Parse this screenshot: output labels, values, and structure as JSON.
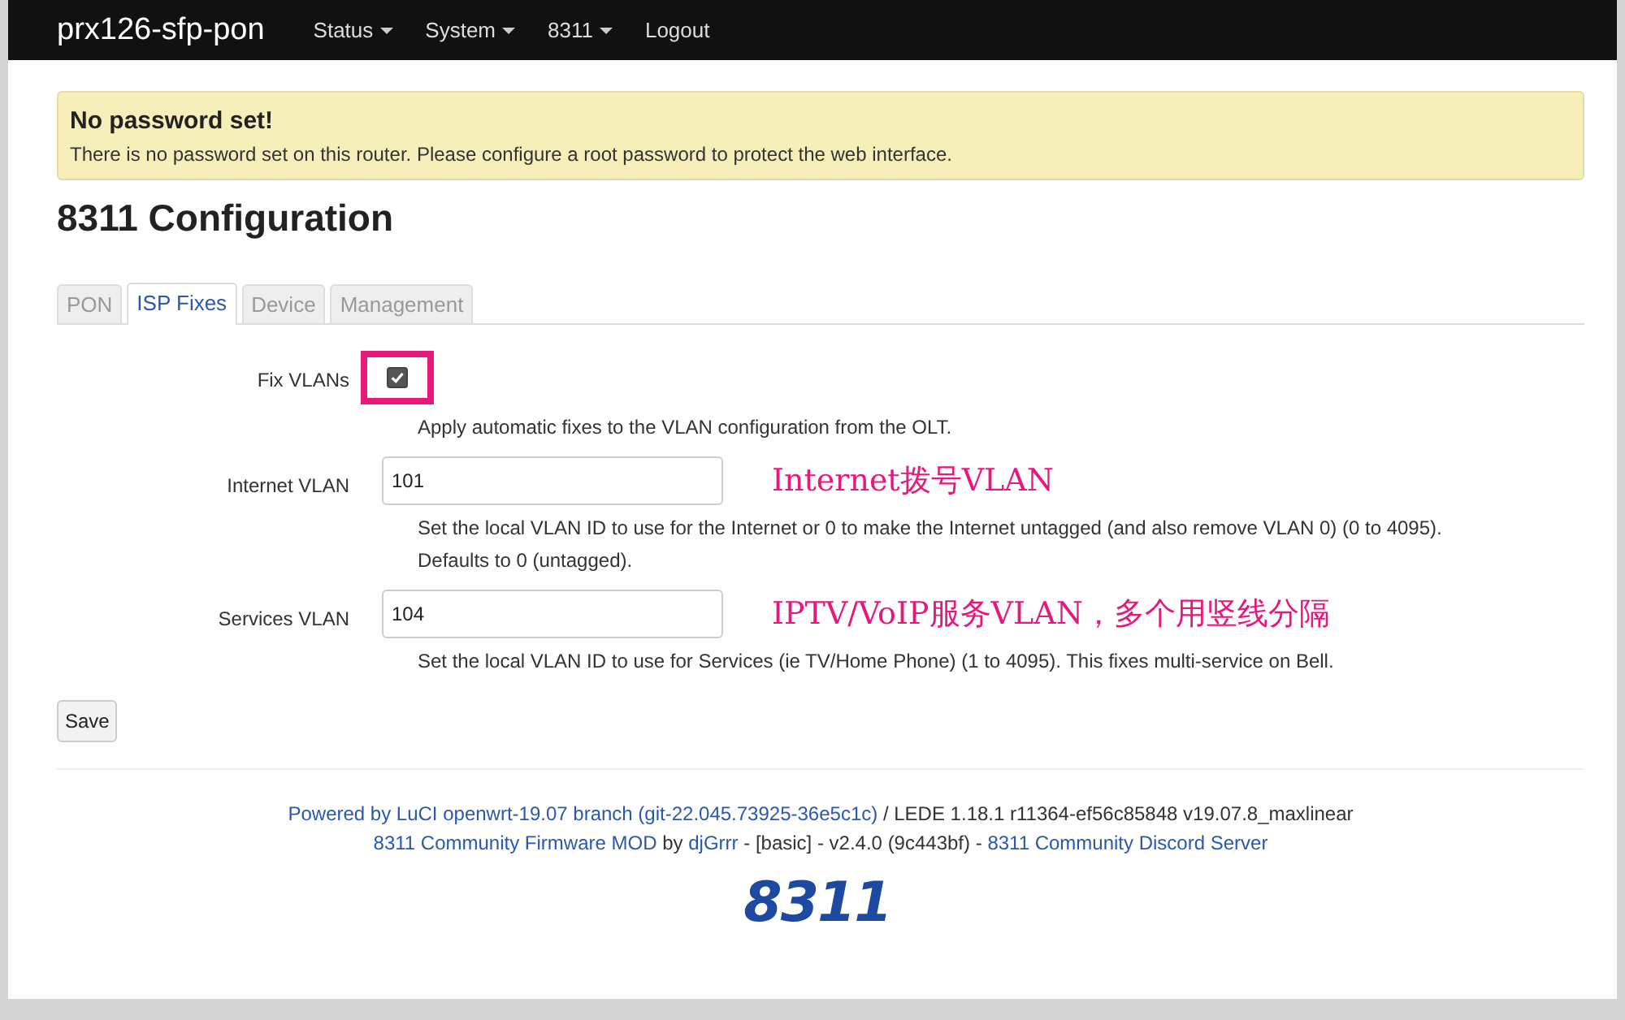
{
  "navbar": {
    "brand": "prx126-sfp-pon",
    "menus": [
      {
        "label": "Status",
        "dropdown": true
      },
      {
        "label": "System",
        "dropdown": true
      },
      {
        "label": "8311",
        "dropdown": true
      },
      {
        "label": "Logout",
        "dropdown": false
      }
    ]
  },
  "alert": {
    "title": "No password set!",
    "message": "There is no password set on this router. Please configure a root password to protect the web interface."
  },
  "heading": "8311 Configuration",
  "tabs": [
    {
      "label": "PON",
      "selected": false
    },
    {
      "label": "ISP Fixes",
      "selected": true
    },
    {
      "label": "Device",
      "selected": false
    },
    {
      "label": "Management",
      "selected": false
    }
  ],
  "fields": [
    {
      "kind": "checkbox",
      "label": "Fix VLANs",
      "checked": true,
      "highlighted": true,
      "description": [
        "Apply automatic fixes to the VLAN configuration from the OLT."
      ]
    },
    {
      "kind": "text",
      "label": "Internet VLAN",
      "value": "101",
      "annotation": "Internet拨号VLAN",
      "description": [
        "Set the local VLAN ID to use for the Internet or 0 to make the Internet untagged (and also remove VLAN 0) (0 to 4095).",
        "Defaults to 0 (untagged)."
      ]
    },
    {
      "kind": "text",
      "label": "Services VLAN",
      "value": "104",
      "annotation": "IPTV/VoIP服务VLAN，多个用竖线分隔",
      "description": [
        "Set the local VLAN ID to use for Services (ie TV/Home Phone) (1 to 4095). This fixes multi-service on Bell."
      ]
    }
  ],
  "save_button": "Save",
  "footer": {
    "lines": [
      [
        {
          "kind": "link",
          "text": "Powered by LuCI openwrt-19.07 branch (git-22.045.73925-36e5c1c)"
        },
        {
          "kind": "text",
          "text": " / LEDE 1.18.1 r11364-ef56c85848 v19.07.8_maxlinear"
        }
      ],
      [
        {
          "kind": "link",
          "text": "8311 Community Firmware MOD"
        },
        {
          "kind": "text",
          "text": " by "
        },
        {
          "kind": "link",
          "text": "djGrrr"
        },
        {
          "kind": "text",
          "text": " - [basic] - v2.4.0 (9c443bf) - "
        },
        {
          "kind": "link",
          "text": "8311 Community Discord Server"
        }
      ]
    ],
    "logo": "8311"
  }
}
